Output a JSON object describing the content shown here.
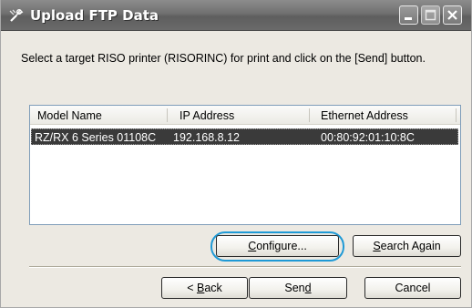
{
  "window": {
    "title": "Upload FTP Data",
    "icons": {
      "app": "tool-icon",
      "minimize": "minimize-icon",
      "maximize": "maximize-icon",
      "close": "close-icon"
    }
  },
  "instruction": "Select a target RISO printer (RISORINC) for print and click on the [Send] button.",
  "printer_list": {
    "columns": [
      "Model Name",
      "IP Address",
      "Ethernet Address"
    ],
    "rows": [
      {
        "model": "RZ/RX 6 Series 01108C",
        "ip": "192.168.8.12",
        "ethernet": "00:80:92:01:10:8C",
        "selected": true
      }
    ]
  },
  "buttons": {
    "configure": {
      "label_pre": "",
      "mnemonic": "C",
      "label_post": "onfigure..."
    },
    "search_again": {
      "label_pre": "",
      "mnemonic": "S",
      "label_post": "earch Again"
    },
    "back": {
      "label_pre": "< ",
      "mnemonic": "B",
      "label_post": "ack"
    },
    "send": {
      "label_pre": "Sen",
      "mnemonic": "d",
      "label_post": ""
    },
    "cancel": {
      "label": "Cancel"
    }
  },
  "colors": {
    "selection": "#3a3a3a",
    "focus_ring": "#1f9ad6",
    "titlebar": "#707070"
  }
}
